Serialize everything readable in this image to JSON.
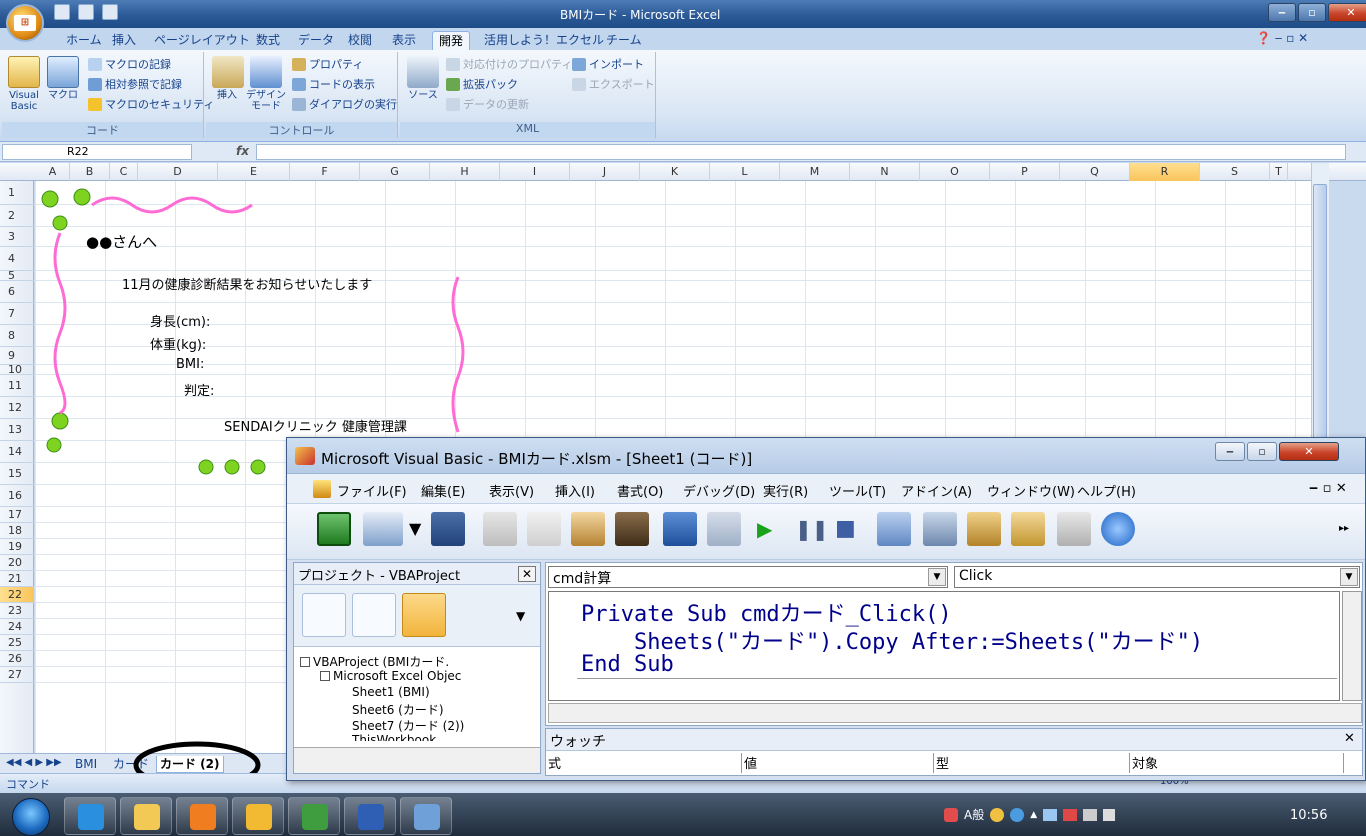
{
  "excel": {
    "title": "BMIカード - Microsoft Excel",
    "tabs": [
      "ホーム",
      "挿入",
      "ページレイアウト",
      "数式",
      "データ",
      "校閲",
      "表示",
      "開発",
      "活用しよう！エクセル",
      "チーム"
    ],
    "active_tab": "開発",
    "ribbon": {
      "code_group": {
        "label": "コード",
        "vb_label": "Visual Basic",
        "macro_label": "マクロ",
        "record": "マクロの記録",
        "relative": "相対参照で記録",
        "security": "マクロのセキュリティ"
      },
      "controls_group": {
        "label": "コントロール",
        "insert": "挿入",
        "design": "デザイン モード",
        "properties": "プロパティ",
        "view_code": "コードの表示",
        "run_dialog": "ダイアログの実行"
      },
      "xml_group": {
        "label": "XML",
        "source": "ソース",
        "map_props": "対応付けのプロパティ",
        "expansion": "拡張パック",
        "refresh": "データの更新",
        "import": "インポート",
        "export": "エクスポート"
      }
    },
    "namebox": "R22",
    "fx": "fx",
    "columns": [
      "A",
      "B",
      "C",
      "D",
      "E",
      "F",
      "G",
      "H",
      "I",
      "J",
      "K",
      "L",
      "M",
      "N",
      "O",
      "P",
      "Q",
      "R",
      "S",
      "T"
    ],
    "selected_column": "R",
    "rows": [
      "1",
      "2",
      "3",
      "4",
      "5",
      "6",
      "7",
      "8",
      "9",
      "10",
      "11",
      "12",
      "13",
      "14",
      "15",
      "16",
      "17",
      "18",
      "19",
      "20",
      "21",
      "22",
      "23",
      "24",
      "25",
      "26",
      "27"
    ],
    "selected_row": "22",
    "cells": {
      "greeting": "●●さんへ",
      "notice": "11月の健康診断結果をお知らせいたします",
      "height": "身長(cm):",
      "weight": "体重(kg):",
      "bmi": "BMI:",
      "judge": "判定:",
      "clinic": "SENDAIクリニック 健康管理課"
    },
    "sheet_tabs": [
      "BMI",
      "カード",
      "カード (2)"
    ],
    "active_sheet": "カード (2)",
    "status_mode": "コマンド",
    "zoom": "100%"
  },
  "vbe": {
    "title": "Microsoft Visual Basic - BMIカード.xlsm - [Sheet1 (コード)]",
    "menu": [
      "ファイル(F)",
      "編集(E)",
      "表示(V)",
      "挿入(I)",
      "書式(O)",
      "デバッグ(D)",
      "実行(R)",
      "ツール(T)",
      "アドイン(A)",
      "ウィンドウ(W)",
      "ヘルプ(H)"
    ],
    "project": {
      "header": "プロジェクト - VBAProject",
      "root": "VBAProject (BMIカード.",
      "folder": "Microsoft Excel Objec",
      "items": [
        "Sheet1 (BMI)",
        "Sheet6 (カード)",
        "Sheet7 (カード (2))",
        "ThisWorkbook"
      ]
    },
    "object_combo": "cmd計算",
    "proc_combo": "Click",
    "code": [
      "Private Sub cmdカード_Click()",
      "    Sheets(\"カード\").Copy After:=Sheets(\"カード\")",
      "End Sub"
    ],
    "watch": {
      "header": "ウォッチ",
      "cols": [
        "式",
        "値",
        "型",
        "対象"
      ]
    }
  },
  "taskbar": {
    "tray_text": "A般",
    "clock": "10:56"
  },
  "colors": {
    "accent": "#2b5a97",
    "code_text": "#00008b",
    "selected_header": "#f9c45c"
  }
}
